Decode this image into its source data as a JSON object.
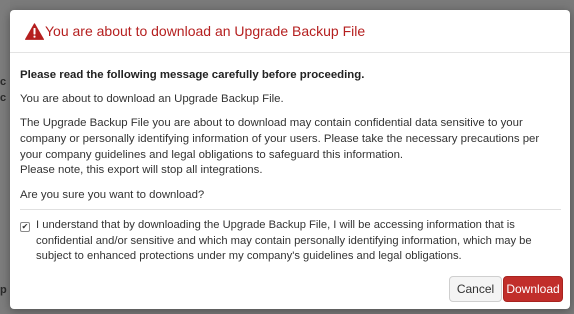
{
  "background": {
    "edge_glyphs": [
      "c",
      "c",
      "p"
    ]
  },
  "modal": {
    "title": "You are about to download an Upgrade Backup File",
    "title_icon": "warning-triangle-icon",
    "title_color": "#b51f1f",
    "body": {
      "lead": "Please read the following message carefully before proceeding.",
      "p1": "You are about to download an Upgrade Backup File.",
      "p2": "The Upgrade Backup File you are about to download may contain confidential data sensitive to your company or personally identifying information of your users. Please take the necessary precautions per your company guidelines and legal obligations to safeguard this information.",
      "p3": "Please note, this export will stop all integrations.",
      "p4": "Are you sure you want to download?"
    },
    "acknowledgement": {
      "checked": true,
      "check_glyph": "✔",
      "text": "I understand that by downloading the Upgrade Backup File, I will be accessing information that is confidential and/or sensitive and which may contain personally identifying information, which may be subject to enhanced protections under my company's guidelines and legal obligations."
    },
    "buttons": {
      "cancel_label": "Cancel",
      "download_label": "Download",
      "download_color": "#c12e2a"
    }
  }
}
